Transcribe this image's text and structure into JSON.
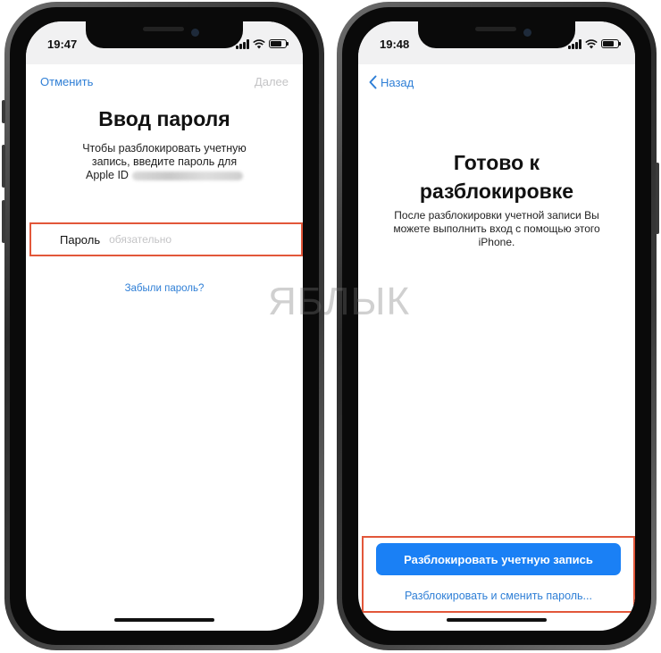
{
  "left_phone": {
    "time": "19:47",
    "nav": {
      "cancel": "Отменить",
      "next": "Далее"
    },
    "title": "Ввод пароля",
    "description_line1": "Чтобы разблокировать учетную",
    "description_line2": "запись, введите пароль для",
    "description_line3": "Apple ID",
    "password_label": "Пароль",
    "password_placeholder": "обязательно",
    "forgot_link": "Забыли пароль?"
  },
  "right_phone": {
    "time": "19:48",
    "back_label": "Назад",
    "title_line1": "Готово к",
    "title_line2": "разблокировке",
    "description_line1": "После разблокировки учетной записи Вы",
    "description_line2": "можете выполнить вход с помощью этого",
    "description_line3": "iPhone.",
    "primary_button": "Разблокировать учетную запись",
    "secondary_link": "Разблокировать и сменить пароль..."
  },
  "watermark": "ЯБЛЫК",
  "colors": {
    "accent_blue": "#1a80f5",
    "link_blue": "#2f7fd6",
    "highlight_red": "#e2573a",
    "disabled_gray": "#c4c4c6"
  }
}
